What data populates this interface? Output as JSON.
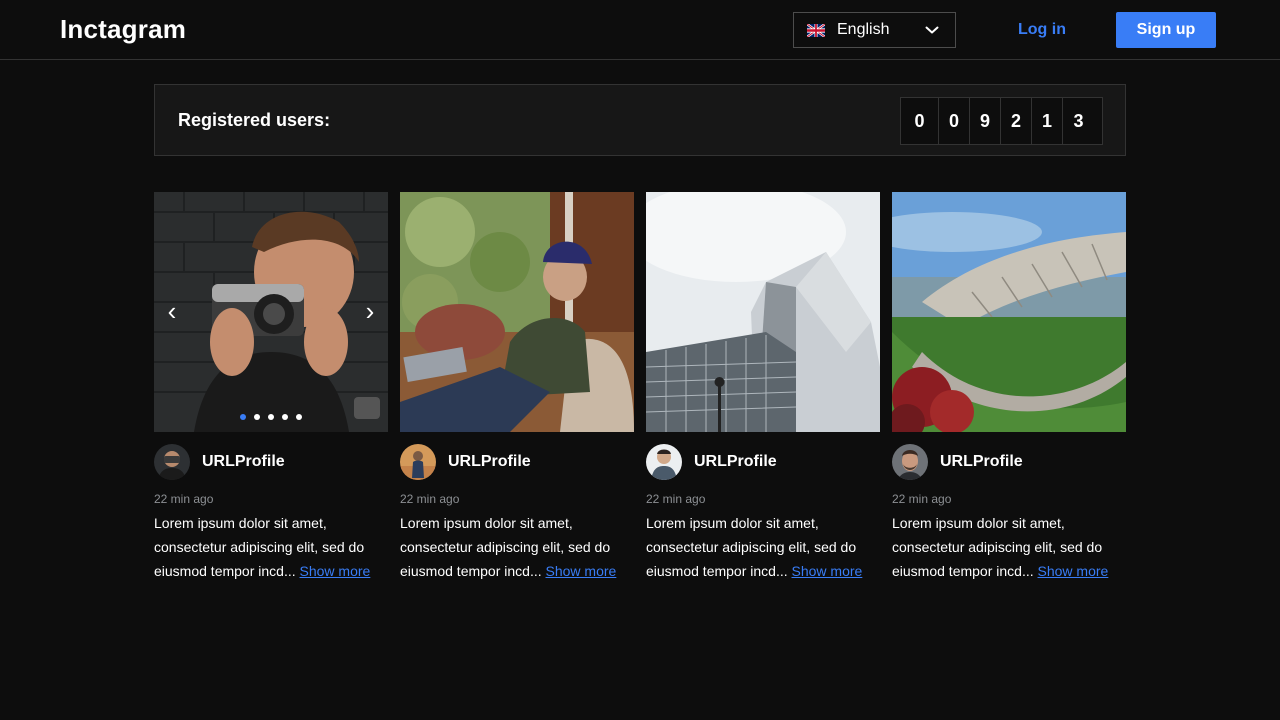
{
  "header": {
    "logo": "Inctagram",
    "language": {
      "selected": "English",
      "flag_icon": "uk-flag-icon"
    },
    "login_label": "Log in",
    "signup_label": "Sign up"
  },
  "counter": {
    "label": "Registered users:",
    "digits": [
      "0",
      "0",
      "9",
      "2",
      "1",
      "3"
    ]
  },
  "posts": [
    {
      "username": "URLProfile",
      "time": "22 min ago",
      "description": "Lorem ipsum dolor sit amet, consectetur adipiscing elit, sed do eiusmod tempor incd...",
      "show_more": "Show more"
    },
    {
      "username": "URLProfile",
      "time": "22 min ago",
      "description": "Lorem ipsum dolor sit amet, consectetur adipiscing elit, sed do eiusmod tempor incd...",
      "show_more": "Show more"
    },
    {
      "username": "URLProfile",
      "time": "22 min ago",
      "description": "Lorem ipsum dolor sit amet, consectetur adipiscing elit, sed do eiusmod tempor incd...",
      "show_more": "Show more"
    },
    {
      "username": "URLProfile",
      "time": "22 min ago",
      "description": "Lorem ipsum dolor sit amet, consectetur adipiscing elit, sed do eiusmod tempor incd...",
      "show_more": "Show more"
    }
  ],
  "carousel": {
    "arrow_left": "‹",
    "arrow_right": "›",
    "slide_count": 5,
    "active_slide": 1
  },
  "colors": {
    "background": "#0d0d0d",
    "accent": "#397df6",
    "border": "#333333",
    "muted_text": "#8d9094"
  }
}
